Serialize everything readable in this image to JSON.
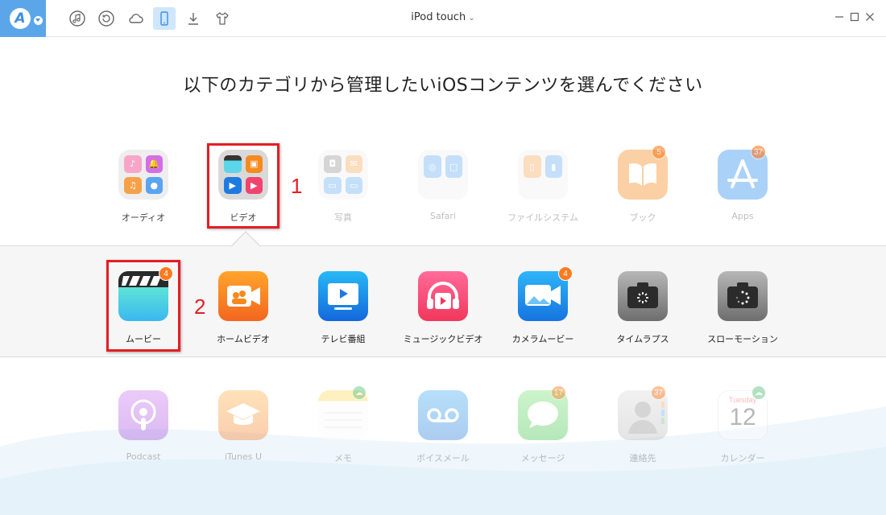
{
  "titlebar": {
    "device_name": "iPod touch",
    "toolbar_icons": [
      "music-icon",
      "restore-icon",
      "cloud-icon",
      "device-icon",
      "download-icon",
      "tshirt-icon"
    ],
    "active_tool": "device-icon"
  },
  "heading": "以下のカテゴリから管理したいiOSコンテンツを選んでください",
  "categories": [
    {
      "label": "オーディオ",
      "icon": "audio-folder-icon",
      "faded": false,
      "badge": ""
    },
    {
      "label": "ビデオ",
      "icon": "video-folder-icon",
      "faded": false,
      "badge": "",
      "selected": true
    },
    {
      "label": "写真",
      "icon": "photos-folder-icon",
      "faded": true,
      "badge": ""
    },
    {
      "label": "Safari",
      "icon": "safari-folder-icon",
      "faded": true,
      "badge": ""
    },
    {
      "label": "ファイルシステム",
      "icon": "filesystem-folder-icon",
      "faded": true,
      "badge": ""
    },
    {
      "label": "ブック",
      "icon": "books-icon",
      "faded": true,
      "badge": "5"
    },
    {
      "label": "Apps",
      "icon": "app-store-icon",
      "faded": true,
      "badge": "37"
    }
  ],
  "video_subcategories": [
    {
      "label": "ムービー",
      "icon": "movies-clapper-icon",
      "badge": "4"
    },
    {
      "label": "ホームビデオ",
      "icon": "home-video-icon",
      "badge": ""
    },
    {
      "label": "テレビ番組",
      "icon": "tv-shows-icon",
      "badge": ""
    },
    {
      "label": "ミュージックビデオ",
      "icon": "music-video-icon",
      "badge": ""
    },
    {
      "label": "カメラムービー",
      "icon": "camera-movie-icon",
      "badge": "4"
    },
    {
      "label": "タイムラプス",
      "icon": "timelapse-icon",
      "badge": ""
    },
    {
      "label": "スローモーション",
      "icon": "slow-motion-icon",
      "badge": ""
    }
  ],
  "more_categories": [
    {
      "label": "Podcast",
      "icon": "podcast-icon",
      "badge": ""
    },
    {
      "label": "iTunes U",
      "icon": "itunes-u-icon",
      "badge": ""
    },
    {
      "label": "メモ",
      "icon": "notes-icon",
      "badge": "cloud"
    },
    {
      "label": "ボイスメール",
      "icon": "voicemail-icon",
      "badge": ""
    },
    {
      "label": "メッセージ",
      "icon": "messages-icon",
      "badge": "17"
    },
    {
      "label": "連絡先",
      "icon": "contacts-icon",
      "badge": "37"
    },
    {
      "label": "カレンダー",
      "icon": "calendar-icon",
      "badge": "cloud",
      "calendar_day": "Tuesday",
      "calendar_date": "12"
    }
  ],
  "annotations": {
    "step1": "1",
    "step2": "2",
    "color": "#e41e25"
  },
  "colors": {
    "accent": "#3b8fe0",
    "badge": "#ff7a1f",
    "cloud_badge": "#55c27a"
  }
}
